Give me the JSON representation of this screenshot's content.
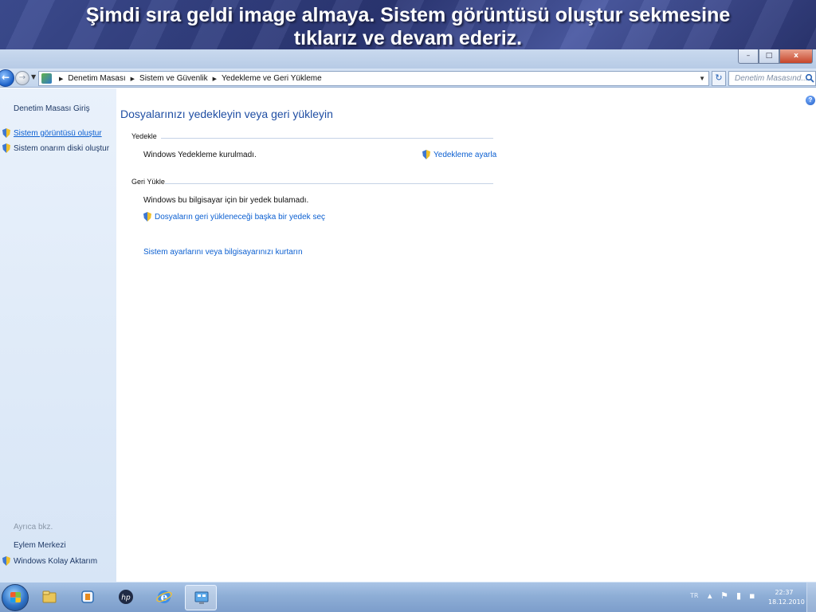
{
  "slide": {
    "title_line1": "Şimdi sıra geldi image almaya. Sistem görüntüsü oluştur sekmesine",
    "title_line2": "tıklarız ve devam ederiz."
  },
  "window": {
    "controls": {
      "minimize": "–",
      "maximize": "□",
      "close": "x"
    }
  },
  "address": {
    "breadcrumbs": [
      "Denetim Masası",
      "Sistem ve Güvenlik",
      "Yedekleme ve Geri Yükleme"
    ],
    "search_placeholder": "Denetim Masasınd..."
  },
  "sidebar": {
    "home": "Denetim Masası Giriş",
    "items": [
      {
        "label": "Sistem görüntüsü oluştur",
        "icon": "shield-icon",
        "active": true
      },
      {
        "label": "Sistem onarım diski oluştur",
        "icon": "shield-icon",
        "active": false
      }
    ],
    "see_also_label": "Ayrıca bkz.",
    "see_also": [
      {
        "label": "Eylem Merkezi"
      },
      {
        "label": "Windows Kolay Aktarım",
        "icon": "shield-icon"
      }
    ]
  },
  "main": {
    "title": "Dosyalarınızı yedekleyin veya geri yükleyin",
    "backup": {
      "header": "Yedekle",
      "status": "Windows Yedekleme kurulmadı.",
      "setup_link": "Yedekleme ayarla"
    },
    "restore": {
      "header": "Geri Yükle",
      "status": "Windows bu bilgisayar için bir yedek bulamadı.",
      "select_link": "Dosyaların geri yükleneceği başka bir yedek seç"
    },
    "recover_link": "Sistem ayarlarını veya bilgisayarınızı kurtarın"
  },
  "taskbar": {
    "pinned": [
      "explorer-icon",
      "media-player-icon",
      "hp-icon",
      "internet-explorer-icon",
      "control-panel-icon"
    ],
    "tray": {
      "language": "TR",
      "time": "22:37",
      "date": "18.12.2010"
    }
  },
  "colors": {
    "banner": "#2d3a78",
    "link": "#0b5fd1",
    "title": "#1f4ea3",
    "sidebar": "#e2ecf8",
    "taskbar": "#8eaed6"
  }
}
